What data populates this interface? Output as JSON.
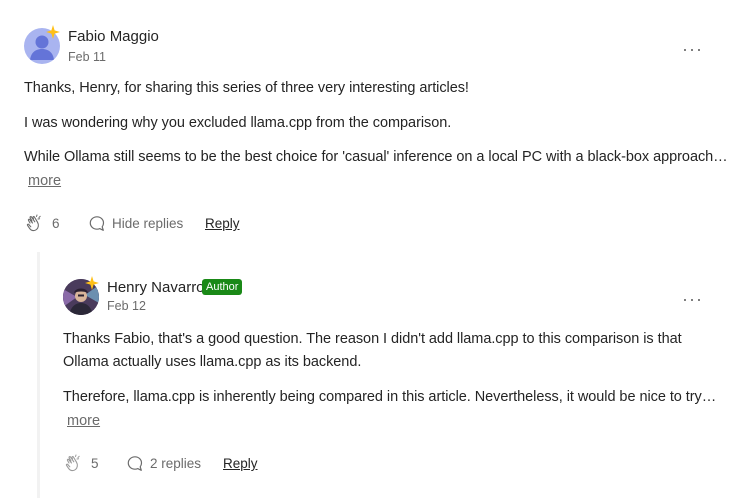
{
  "comment": {
    "author": "Fabio Maggio",
    "date": "Feb 11",
    "paragraphs": [
      "Thanks, Henry, for sharing this series of three very interesting articles!",
      "I was wondering why you excluded llama.cpp from the comparison.",
      "While Ollama still seems to be the best choice for 'casual' inference on a local PC with a black-box approach…"
    ],
    "more_label": "more",
    "clap_count": "6",
    "replies_label": "Hide replies",
    "reply_label": "Reply",
    "menu_label": "···"
  },
  "reply": {
    "author": "Henry Navarro",
    "badge": "Author",
    "date": "Feb 12",
    "paragraphs": [
      "Thanks Fabio, that's a good question. The reason I didn't add llama.cpp to this comparison is that",
      "Ollama actually uses llama.cpp as its backend.",
      "Therefore, llama.cpp is inherently being compared in this article. Nevertheless, it would be nice to try…"
    ],
    "more_label": "more",
    "clap_count": "5",
    "replies_label": "2 replies",
    "reply_label": "Reply",
    "menu_label": "···"
  },
  "colors": {
    "badge_green": "#1a8917",
    "muted_text": "#6b6b6b",
    "text": "#242424",
    "star_gold": "#ffc017"
  }
}
